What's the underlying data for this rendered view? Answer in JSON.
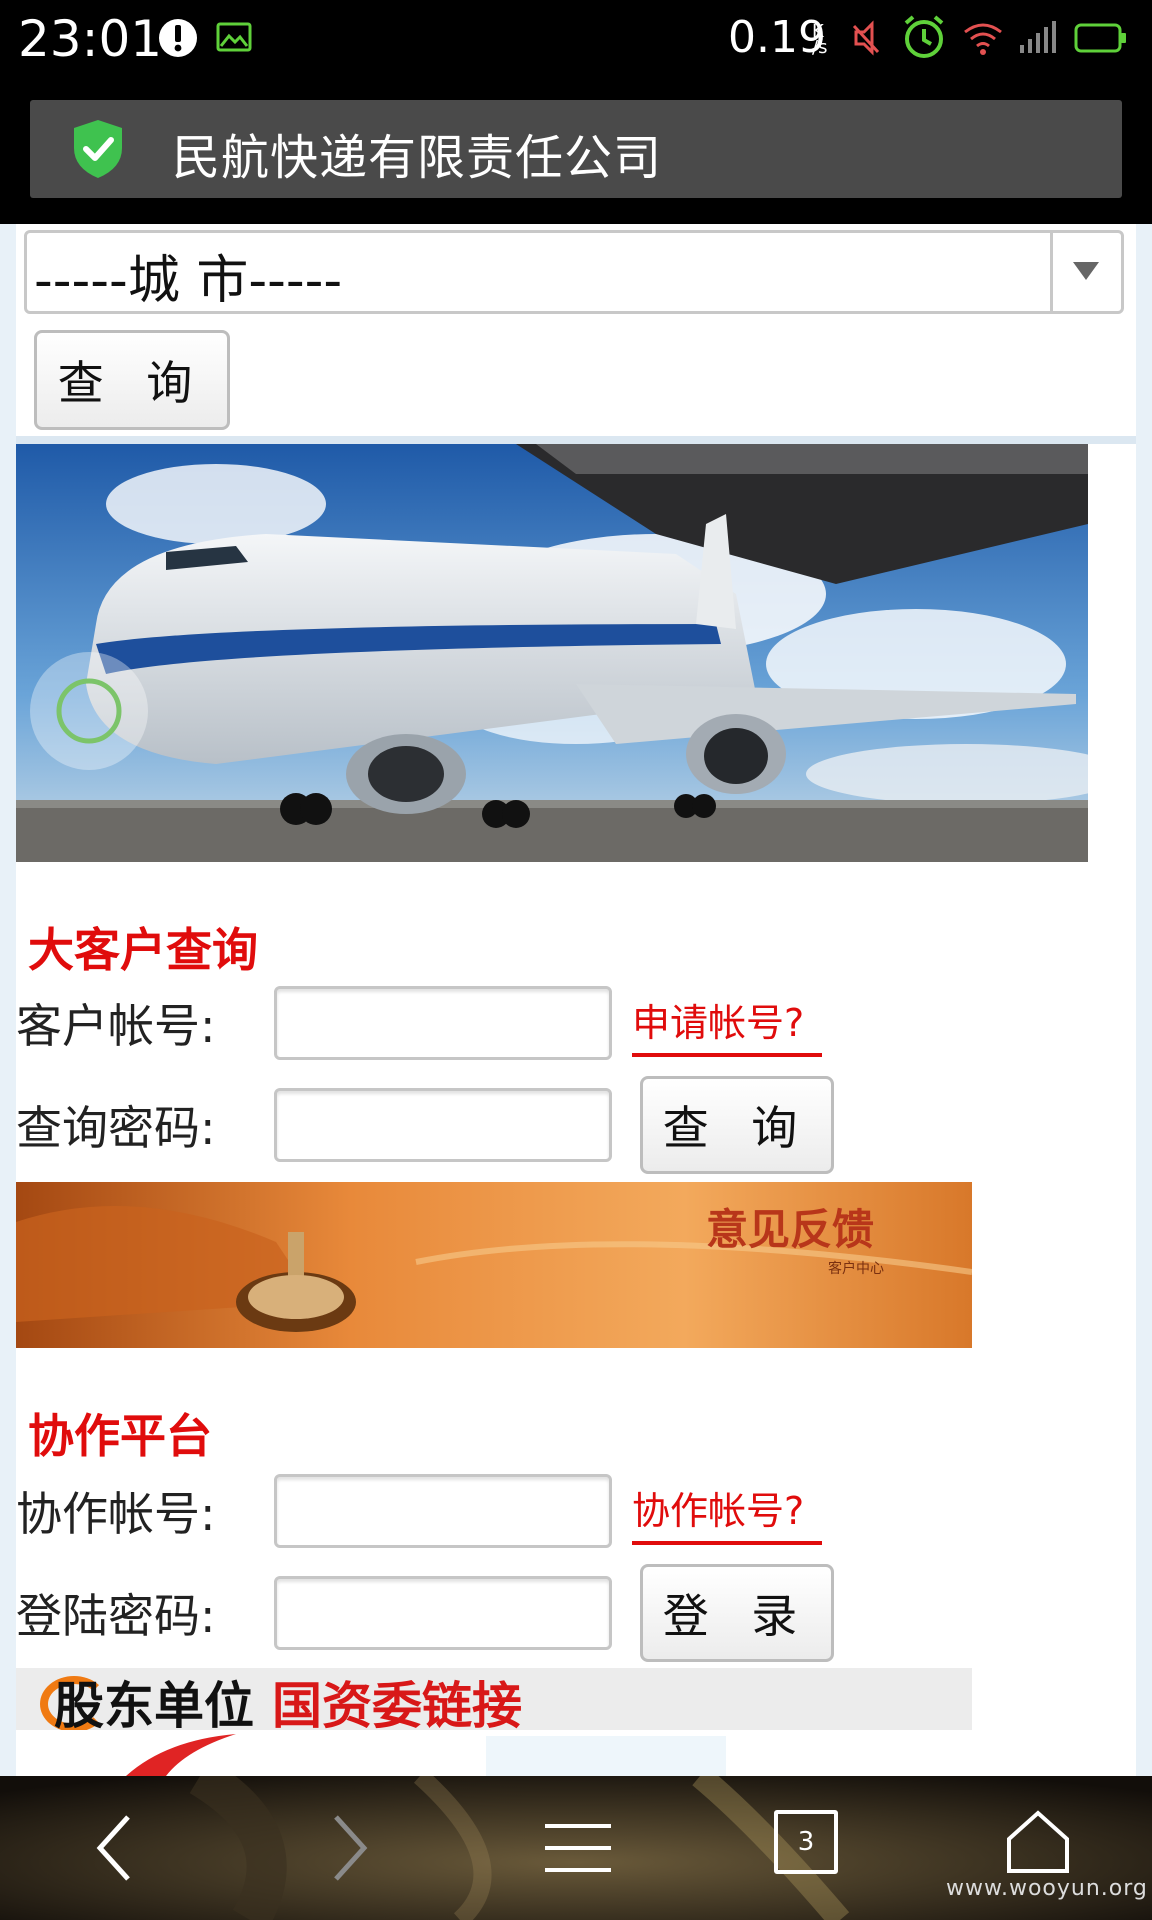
{
  "status_bar": {
    "time": "23:01",
    "net_speed": "0.19",
    "net_speed_unit_top": "K",
    "net_speed_unit_bottom": "/s",
    "icons": [
      "alert-icon",
      "image-icon",
      "mute-icon",
      "alarm-icon",
      "wifi-icon",
      "signal-icon",
      "battery-icon"
    ]
  },
  "title_bar": {
    "title": "民航快递有限责任公司",
    "icon": "shield-check-icon"
  },
  "city_search": {
    "select_value": "-----城 市-----",
    "query_button": "查 询"
  },
  "vip_query": {
    "heading": "大客户查询",
    "account_label": "客户帐号:",
    "password_label": "查询密码:",
    "apply_link": "申请帐号?",
    "query_button": "查 询"
  },
  "feedback_banner": {
    "text": "意见反馈",
    "subtext": "客户中心"
  },
  "cooperation": {
    "heading": "协作平台",
    "account_label": "协作帐号:",
    "password_label": "登陆密码:",
    "account_link": "协作帐号?",
    "login_button": "登 录"
  },
  "shareholder": {
    "label": "股东单位",
    "link": "国资委链接"
  },
  "nav_bar": {
    "tabs_count": "3",
    "watermark": "www.wooyun.org"
  },
  "colors": {
    "accent_red": "#e00c0c",
    "title_bar_bg": "#4a4a4a",
    "status_green": "#5fd13a"
  }
}
